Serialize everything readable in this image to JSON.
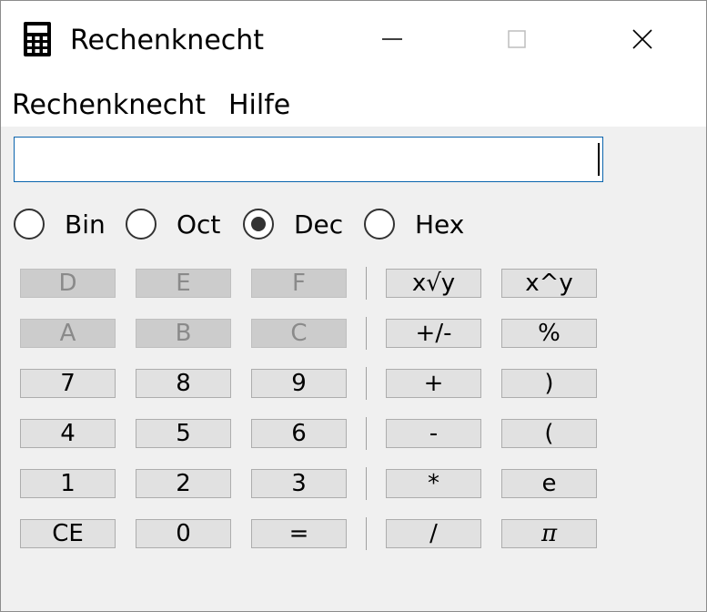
{
  "window": {
    "title": "Rechenknecht",
    "icon": "calculator-icon",
    "controls": [
      "minimize-icon",
      "maximize-icon",
      "close-icon"
    ]
  },
  "menu": {
    "items": [
      "Rechenknecht",
      "Hilfe"
    ]
  },
  "display": {
    "value": ""
  },
  "modes": [
    {
      "label": "Bin",
      "checked": false
    },
    {
      "label": "Oct",
      "checked": false
    },
    {
      "label": "Dec",
      "checked": true
    },
    {
      "label": "Hex",
      "checked": false
    }
  ],
  "keypad": {
    "rows": [
      {
        "left": [
          "D",
          "E",
          "F"
        ],
        "right": [
          "x√y",
          "x^y"
        ]
      },
      {
        "left": [
          "A",
          "B",
          "C"
        ],
        "right": [
          "+/-",
          "%"
        ]
      },
      {
        "left": [
          "7",
          "8",
          "9"
        ],
        "right": [
          "+",
          ")"
        ]
      },
      {
        "left": [
          "4",
          "5",
          "6"
        ],
        "right": [
          "-",
          "("
        ]
      },
      {
        "left": [
          "1",
          "2",
          "3"
        ],
        "right": [
          "*",
          "e"
        ]
      },
      {
        "left": [
          "CE",
          "0",
          "="
        ],
        "right": [
          "/",
          "π"
        ]
      }
    ],
    "disabled_keys": [
      "D",
      "E",
      "F",
      "A",
      "B",
      "C"
    ]
  },
  "colors": {
    "window_bg": "#f0f0f0",
    "key_bg": "#e1e1e1",
    "key_disabled_bg": "#cccccc",
    "key_disabled_text": "#8a8a8a",
    "focus_border": "#0a64ad"
  }
}
